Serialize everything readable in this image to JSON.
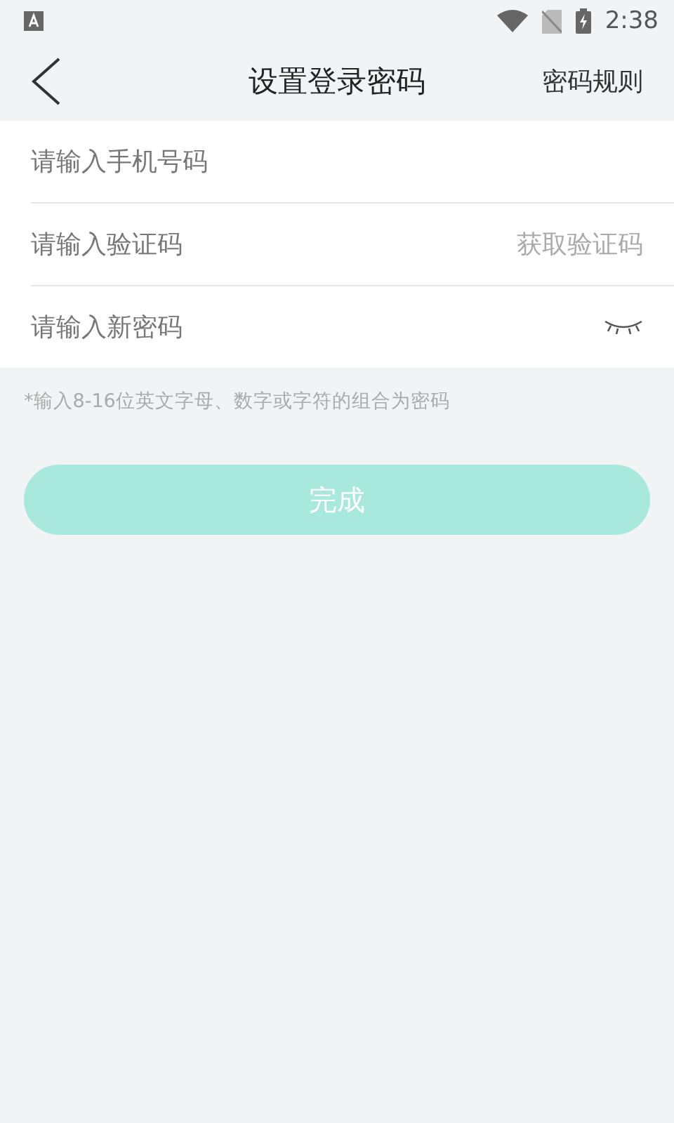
{
  "status_bar": {
    "time": "2:38"
  },
  "header": {
    "title": "设置登录密码",
    "action": "密码规则"
  },
  "fields": [
    {
      "kind": "phone",
      "placeholder": "请输入手机号码"
    },
    {
      "kind": "code",
      "placeholder": "请输入验证码",
      "action": "获取验证码"
    },
    {
      "kind": "password",
      "placeholder": "请输入新密码"
    }
  ],
  "hint": "*输入8-16位英文字母、数字或字符的组合为密码",
  "submit": {
    "label": "完成",
    "disabled": true
  }
}
